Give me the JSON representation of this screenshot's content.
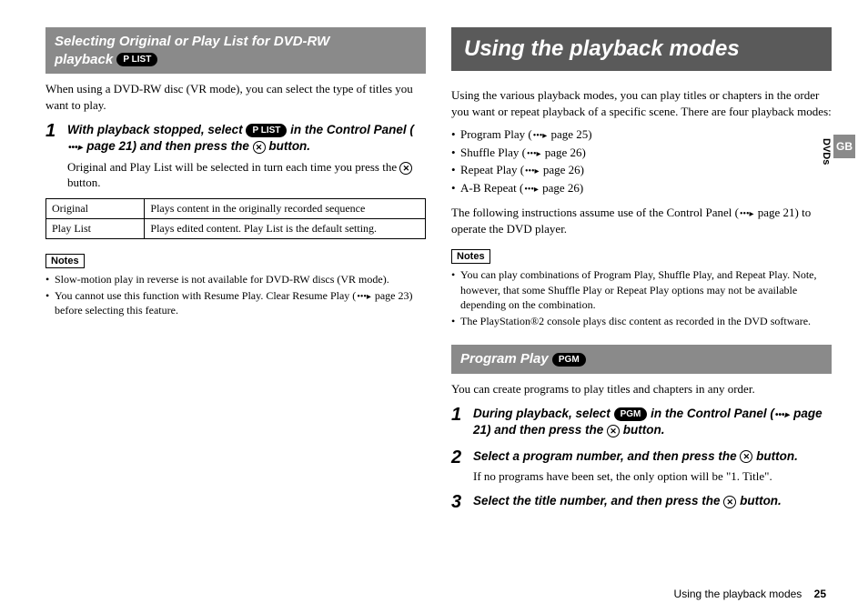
{
  "left": {
    "headerLine1": "Selecting Original or Play List for DVD-RW",
    "headerLine2": "playback",
    "headerBadge": "P LIST",
    "intro": "When using a DVD-RW disc (VR mode), you can select the type of titles you want to play.",
    "step1": {
      "num": "1",
      "t1": "With playback stopped, select ",
      "badge": "P LIST",
      "t2": " in the Control Panel (",
      "t3": " page 21) and then press the ",
      "t4": " button.",
      "desc1": "Original and Play List will be selected in turn each time you press the ",
      "desc2": " button."
    },
    "table": {
      "r1c1": "Original",
      "r1c2": "Plays content in the originally recorded sequence",
      "r2c1": "Play List",
      "r2c2": "Plays edited content. Play List is the default setting."
    },
    "notesLabel": "Notes",
    "notes": {
      "n1": "Slow-motion play in reverse is not available for DVD-RW discs (VR mode).",
      "n2a": "You cannot use this function with Resume Play. Clear Resume Play (",
      "n2b": " page 23) before selecting this feature."
    }
  },
  "right": {
    "banner": "Using the playback modes",
    "intro": "Using the various playback modes, you can play titles or chapters in the order you want or repeat playback of a specific scene. There are four playback modes:",
    "bullets": {
      "b1a": "Program Play (",
      "b1b": " page 25)",
      "b2a": "Shuffle Play (",
      "b2b": " page 26)",
      "b3a": "Repeat Play (",
      "b3b": " page 26)",
      "b4a": "A-B Repeat (",
      "b4b": " page 26)"
    },
    "after1": "The following instructions assume use of the Control Panel (",
    "after2": " page 21) to operate the DVD player.",
    "notesLabel": "Notes",
    "notes": {
      "n1": "You can play combinations of Program Play, Shuffle Play, and Repeat Play. Note, however, that some Shuffle Play or Repeat Play options may not be available depending on the combination.",
      "n2": "The PlayStation®2 console plays disc content as recorded in the DVD software."
    },
    "prog": {
      "header": "Program Play",
      "badge": "PGM",
      "intro": "You can create programs to play titles and chapters in any order.",
      "s1": {
        "num": "1",
        "t1": "During playback, select ",
        "badge": "PGM",
        "t2": " in the Control Panel (",
        "t3": " page 21) and then press the ",
        "t4": " button."
      },
      "s2": {
        "num": "2",
        "t1": "Select a program number, and then press the ",
        "t2": " button.",
        "desc": "If no programs have been set, the only option will be \"1. Title\"."
      },
      "s3": {
        "num": "3",
        "t1": "Select the title number, and then press the ",
        "t2": " button."
      }
    }
  },
  "side": {
    "gb": "GB",
    "dvds": "DVDs"
  },
  "footer": {
    "text": "Using the playback modes",
    "page": "25"
  },
  "glyphs": {
    "xref": "•••▸",
    "x": "✕"
  }
}
